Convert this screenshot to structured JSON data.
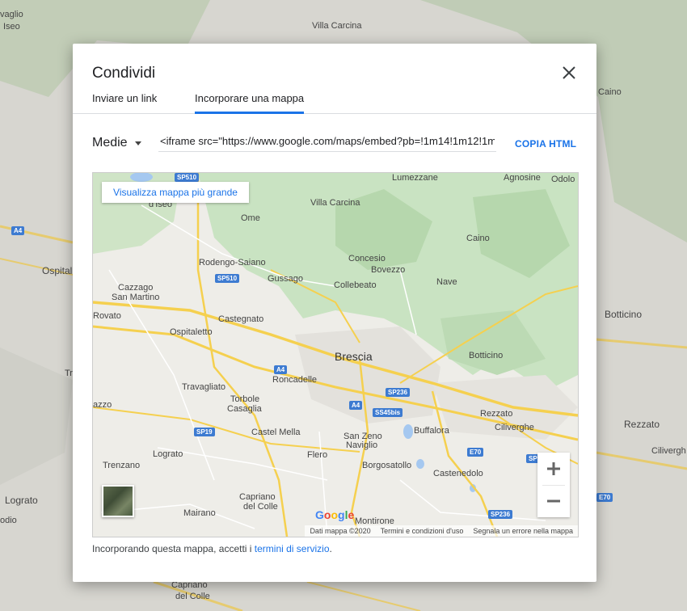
{
  "background_map": {
    "labels": [
      "vaglio",
      "Iseo",
      "Villa Carcina",
      "Caino",
      "A4",
      "Ospital",
      "Tr",
      "Botticino",
      "Rezzato",
      "Cilivergh",
      "Lograto",
      "odio",
      "Capriano",
      "del Colle",
      "E70"
    ]
  },
  "dialog": {
    "title": "Condividi",
    "tabs": [
      {
        "label": "Inviare un link",
        "active": false
      },
      {
        "label": "Incorporare una mappa",
        "active": true
      }
    ],
    "size_select": "Medie",
    "embed_code": "<iframe src=\"https://www.google.com/maps/embed?pb=!1m14!1m12!1m3",
    "copy_label": "COPIA HTML",
    "larger_map_label": "Visualizza mappa più grande",
    "map_labels": {
      "lumezzane": "Lumezzane",
      "agnosine": "Agnosine",
      "odolo": "Odolo",
      "villa_carcina": "Villa Carcina",
      "iseo": "d'Iseo",
      "ome": "Ome",
      "caino": "Caino",
      "rodengo": "Rodengo-Saiano",
      "concesio": "Concesio",
      "bovezzo": "Bovezzo",
      "gussago": "Gussago",
      "collebeato": "Collebeato",
      "nave": "Nave",
      "cazzago": "Cazzago",
      "san_martino": "San Martino",
      "rovato": "Rovato",
      "castegnato": "Castegnato",
      "ospitaletto": "Ospitaletto",
      "brescia": "Brescia",
      "botticino": "Botticino",
      "roncadelle": "Roncadelle",
      "travagliato": "Travagliato",
      "torbole": "Torbole",
      "casaglia": "Casaglia",
      "rezzato": "Rezzato",
      "ciliverghe": "Ciliverghe",
      "san_zeno": "San Zeno",
      "naviglio": "Naviglio",
      "buffalora": "Buffalora",
      "castel_mella": "Castel Mella",
      "flero": "Flero",
      "lograto": "Lograto",
      "trenzano": "Trenzano",
      "borgosatollo": "Borgosatollo",
      "castenedolo": "Castenedolo",
      "capriano": "Capriano",
      "del_colle": "del Colle",
      "mairano": "Mairano",
      "montirone": "Montirone",
      "azzo": "azzo"
    },
    "shields": {
      "sp510_top": "SP510",
      "a4_bg": "A4",
      "sp510": "SP510",
      "a4": "A4",
      "a4b": "A4",
      "sp236": "SP236",
      "ss45bis": "SS45bis",
      "sp19": "SP19",
      "e70": "E70",
      "sp236b": "SP236",
      "sp_edge": "SP"
    },
    "google_logo": "Google",
    "attribution": [
      "Dati mappa ©2020",
      "Termini e condizioni d'uso",
      "Segnala un errore nella mappa"
    ],
    "footer_text": "Incorporando questa mappa, accetti i ",
    "footer_link": "termini di servizio",
    "footer_end": ".",
    "colors": {
      "accent": "#1a73e8",
      "highway": "#f9d74c",
      "forest": "#c9e3c2",
      "shield": "#3d7bd1"
    }
  }
}
